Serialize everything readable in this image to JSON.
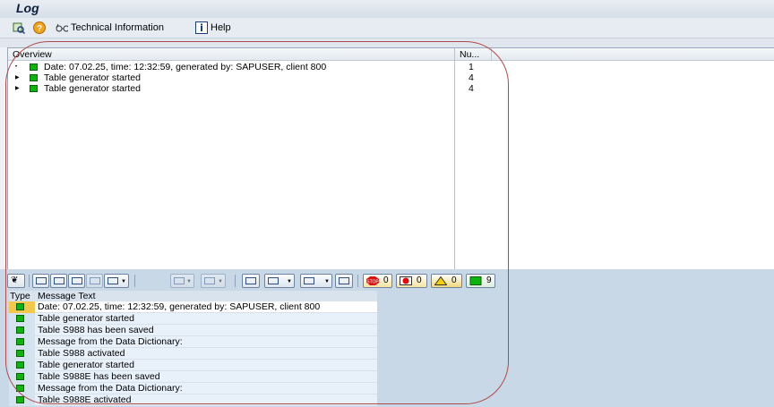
{
  "window": {
    "title": "Log"
  },
  "appbar": {
    "technical_information": "Technical Information",
    "help": "Help"
  },
  "overview": {
    "header": "Overview",
    "num_header": "Nu...",
    "rows": [
      {
        "text": "Date: 07.02.25, time: 12:32:59, generated by: SAPUSER, client 800",
        "num": "1"
      },
      {
        "text": "Table generator started",
        "num": "4"
      },
      {
        "text": "Table generator started",
        "num": "4"
      }
    ]
  },
  "counters": {
    "stop": "0",
    "error": "0",
    "warning": "0",
    "success": "9"
  },
  "messages": {
    "header_type": "Type",
    "header_text": "Message Text",
    "rows": [
      "Date: 07.02.25, time: 12:32:59, generated by: SAPUSER, client 800",
      "Table generator started",
      "Table S988 has been saved",
      "Message from the Data Dictionary:",
      "Table S988 activated",
      "Table generator started",
      "Table S988E has been saved",
      "Message from the Data Dictionary:",
      "Table S988E activated"
    ]
  },
  "colors": {
    "status_green": "#0db40d",
    "annotation_oval": "#b04a4a",
    "selected_row": "#f3c84b"
  }
}
